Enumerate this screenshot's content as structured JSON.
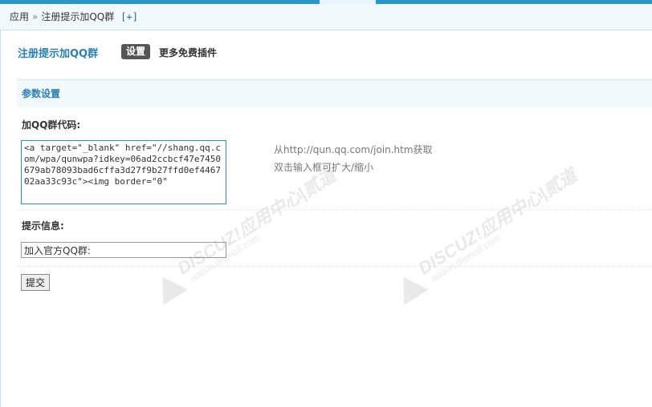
{
  "breadcrumb": {
    "root": "应用",
    "separator": "»",
    "current": "注册提示加QQ群",
    "add_label": "[+]"
  },
  "plugin": {
    "title": "注册提示加QQ群",
    "active_tab": "设置",
    "more_link": "更多免费插件"
  },
  "section": {
    "title": "参数设置"
  },
  "form": {
    "code_label": "加QQ群代码:",
    "code_value": "<a target=\"_blank\" href=\"//shang.qq.com/wpa/qunwpa?idkey=06ad2ccbcf47e7450679ab78093bad6cffa3d27f9b27ffd0ef446702aa33c93c\"><img border=\"0\"",
    "code_tip_1": "从http://qun.qq.com/join.htm获取",
    "code_tip_2": "双击输入框可扩大/缩小",
    "message_label": "提示信息:",
    "message_value": "加入官方QQ群:",
    "submit_label": "提交"
  },
  "watermark": {
    "brand": "DISCUZ!应用中心|贰道",
    "domain": "addon.dismall.com"
  },
  "colors": {
    "accent": "#2b7fb3",
    "top_bar": "#2a98c7",
    "header_bg": "#f2f9fd",
    "active_tab_bg": "#555555"
  }
}
